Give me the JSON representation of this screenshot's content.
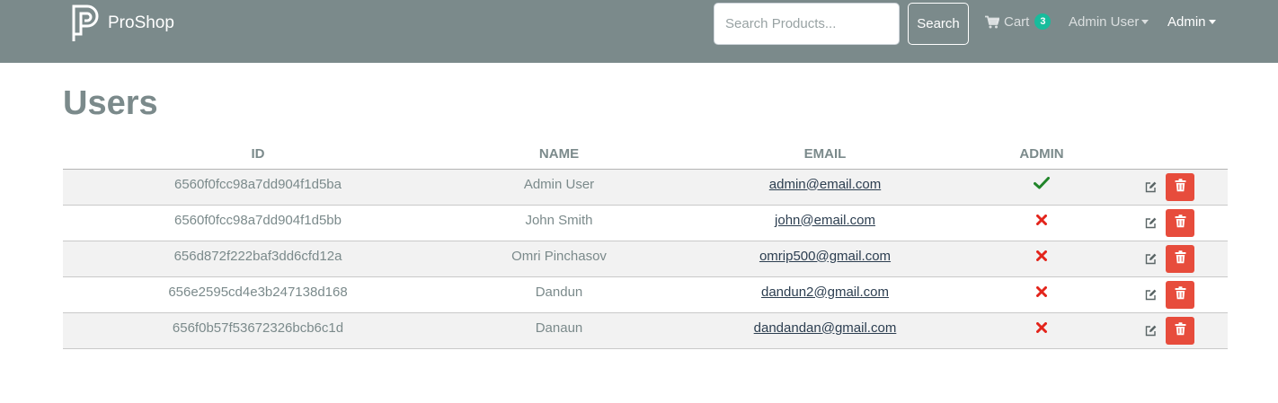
{
  "header": {
    "brand": "ProShop",
    "search_placeholder": "Search Products...",
    "search_button": "Search",
    "cart_label": "Cart",
    "cart_count": "3",
    "user_menu": "Admin User",
    "admin_menu": "Admin"
  },
  "page": {
    "title": "Users"
  },
  "table": {
    "headers": [
      "ID",
      "NAME",
      "EMAIL",
      "ADMIN"
    ],
    "rows": [
      {
        "id": "6560f0fcc98a7dd904f1d5ba",
        "name": "Admin User",
        "email": "admin@email.com",
        "is_admin": true
      },
      {
        "id": "6560f0fcc98a7dd904f1d5bb",
        "name": "John Smith",
        "email": "john@email.com",
        "is_admin": false
      },
      {
        "id": "656d872f222baf3dd6cfd12a",
        "name": "Omri Pinchasov",
        "email": "omrip500@gmail.com",
        "is_admin": false
      },
      {
        "id": "656e2595cd4e3b247138d168",
        "name": "Dandun",
        "email": "dandun2@gmail.com",
        "is_admin": false
      },
      {
        "id": "656f0b57f53672326bcb6c1d",
        "name": "Danaun",
        "email": "dandandan@gmail.com",
        "is_admin": false
      }
    ]
  },
  "icons": {
    "brand": "logo-p-icon",
    "cart": "shopping-cart-icon",
    "admin_true": "check-icon",
    "admin_false": "x-icon",
    "edit": "edit-icon",
    "delete": "trash-icon"
  },
  "colors": {
    "navbar": "#7b8a8b",
    "badge": "#18bc9c",
    "check": "#21852a",
    "cross": "#e3241b",
    "delete_button": "#e74c3c",
    "row_stripe": "#f2f2f2"
  }
}
